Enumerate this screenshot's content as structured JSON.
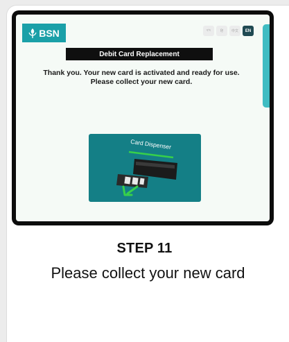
{
  "screen": {
    "brand": "BSN",
    "languages": [
      "বাং",
      "हिं",
      "中文",
      "EN"
    ],
    "active_language": "EN",
    "title": "Debit Card Replacement",
    "message_line1": "Thank you. Your new card is activated and ready for use.",
    "message_line2": "Please collect your new card.",
    "dispenser_label": "Card Dispenser"
  },
  "step": {
    "title": "STEP 11",
    "description": "Please collect your new card"
  },
  "colors": {
    "brand_teal": "#1aa0a8",
    "dispenser_teal": "#147f86",
    "accent_green": "#37d04a",
    "active_lang_bg": "#1f4952"
  },
  "icons": [
    "bsn-logo-icon",
    "card-slot-icon",
    "arrow-down-left-icon"
  ]
}
